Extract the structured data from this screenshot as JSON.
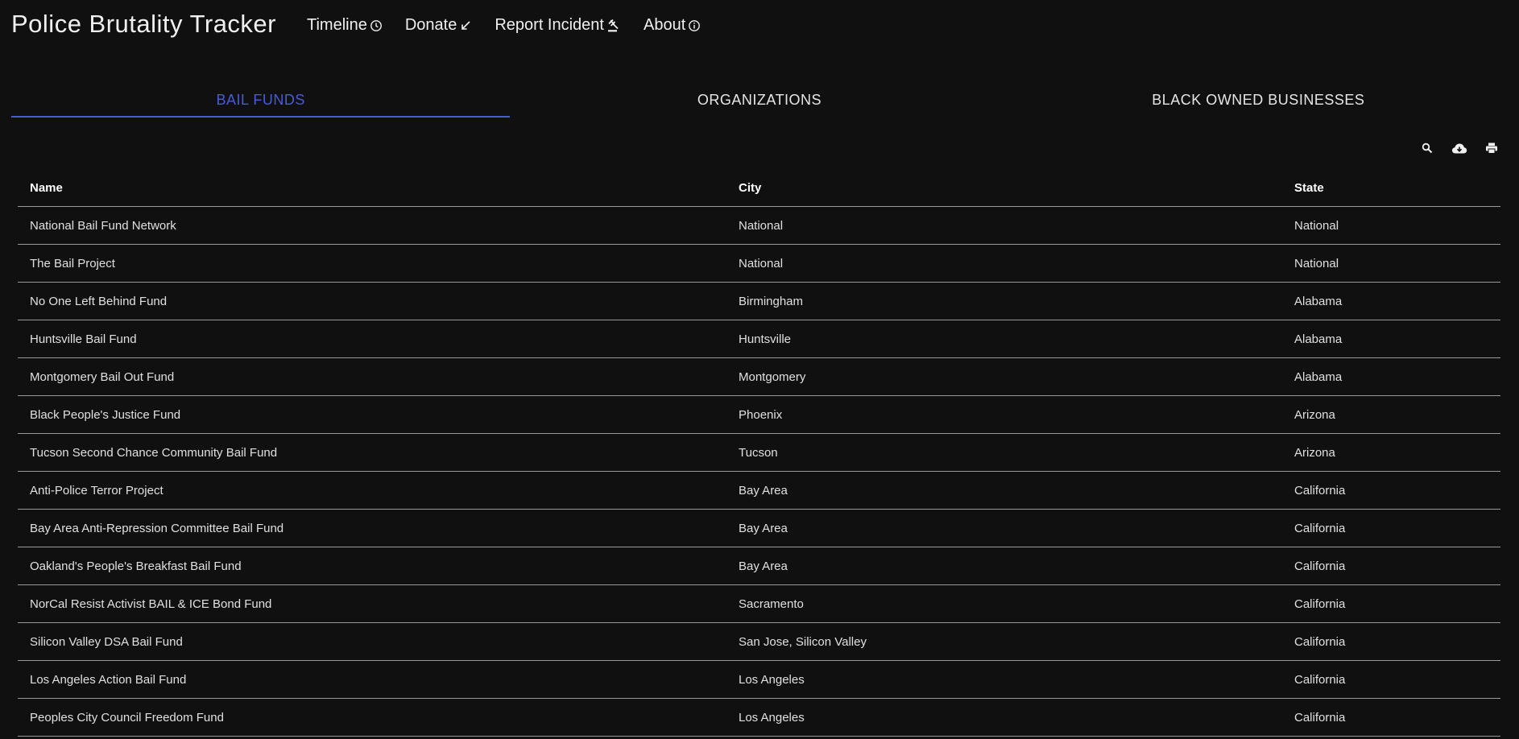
{
  "app": {
    "title": "Police Brutality Tracker"
  },
  "nav": [
    {
      "label": "Timeline",
      "icon": "clock-icon"
    },
    {
      "label": "Donate",
      "icon": "arrow-down-left-icon"
    },
    {
      "label": "Report Incident",
      "icon": "gavel-icon"
    },
    {
      "label": "About",
      "icon": "info-icon"
    }
  ],
  "tabs": [
    {
      "label": "BAIL FUNDS",
      "active": true
    },
    {
      "label": "ORGANIZATIONS",
      "active": false
    },
    {
      "label": "BLACK OWNED BUSINESSES",
      "active": false
    }
  ],
  "toolbar": {
    "icons": [
      "search-icon",
      "cloud-download-icon",
      "print-icon"
    ]
  },
  "accent_color": "#4a5bd6",
  "table": {
    "columns": [
      "Name",
      "City",
      "State"
    ],
    "rows": [
      [
        "National Bail Fund Network",
        "National",
        "National"
      ],
      [
        "The Bail Project",
        "National",
        "National"
      ],
      [
        "No One Left Behind Fund",
        "Birmingham",
        "Alabama"
      ],
      [
        "Huntsville Bail Fund",
        "Huntsville",
        "Alabama"
      ],
      [
        "Montgomery Bail Out Fund",
        "Montgomery",
        "Alabama"
      ],
      [
        "Black People's Justice Fund",
        "Phoenix",
        "Arizona"
      ],
      [
        "Tucson Second Chance Community Bail Fund",
        "Tucson",
        "Arizona"
      ],
      [
        "Anti-Police Terror Project",
        "Bay Area",
        "California"
      ],
      [
        "Bay Area Anti-Repression Committee Bail Fund",
        "Bay Area",
        "California"
      ],
      [
        "Oakland's People's Breakfast Bail Fund",
        "Bay Area",
        "California"
      ],
      [
        "NorCal Resist Activist BAIL & ICE Bond Fund",
        "Sacramento",
        "California"
      ],
      [
        "Silicon Valley DSA Bail Fund",
        "San Jose, Silicon Valley",
        "California"
      ],
      [
        "Los Angeles Action Bail Fund",
        "Los Angeles",
        "California"
      ],
      [
        "Peoples City Council Freedom Fund",
        "Los Angeles",
        "California"
      ]
    ]
  }
}
